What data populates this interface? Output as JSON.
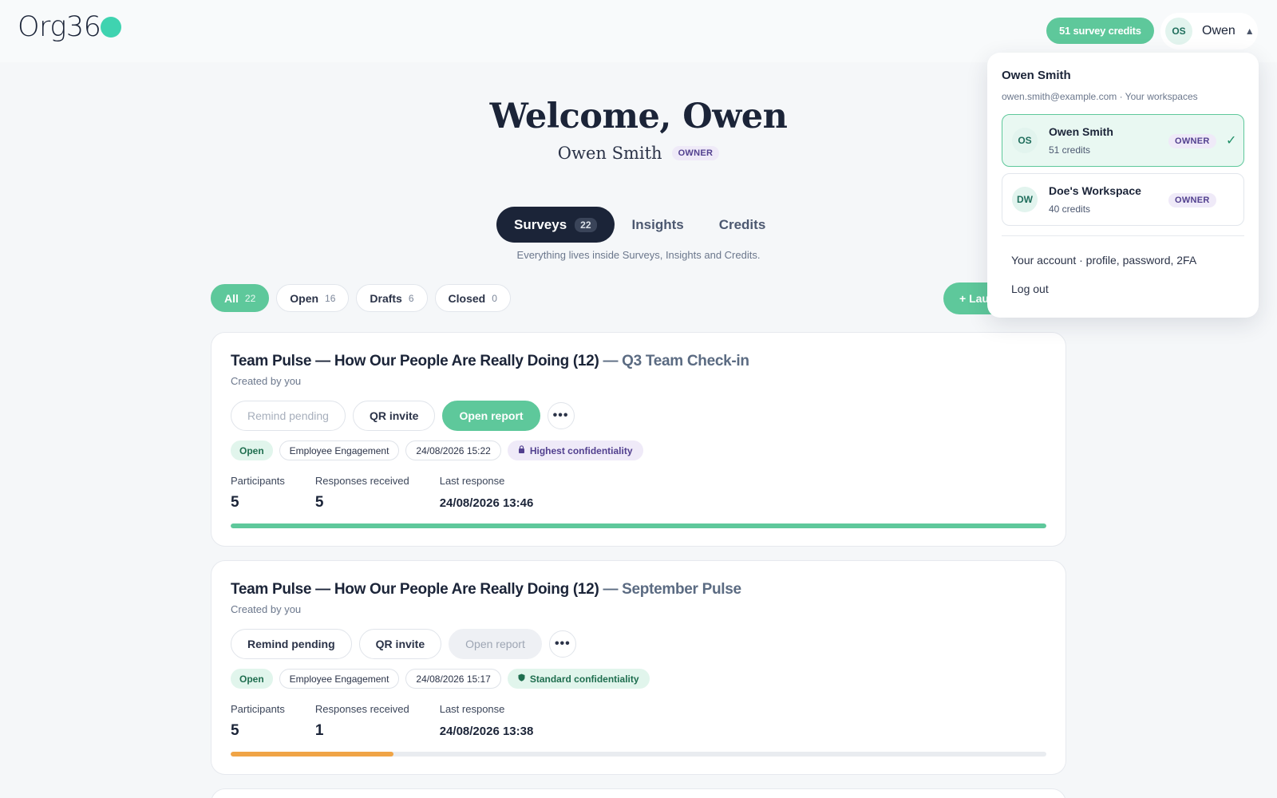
{
  "brand": {
    "logo_text": "Org36"
  },
  "header": {
    "credits_pill": "51 survey credits",
    "user_initials": "OS",
    "user_name": "Owen",
    "caret": "▲"
  },
  "hero": {
    "title": "Welcome, Owen",
    "full_name": "Owen Smith",
    "role_badge": "OWNER"
  },
  "tabs": [
    {
      "label": "Surveys",
      "count": "22",
      "active": true
    },
    {
      "label": "Insights"
    },
    {
      "label": "Credits"
    }
  ],
  "tabs_help": "Everything lives inside Surveys, Insights and Credits.",
  "filters": [
    {
      "label": "All",
      "count": "22",
      "active": true
    },
    {
      "label": "Open",
      "count": "16"
    },
    {
      "label": "Drafts",
      "count": "6"
    },
    {
      "label": "Closed",
      "count": "0"
    }
  ],
  "launch_button": "+ Lau",
  "surveys": [
    {
      "title": "Team Pulse — How Our People Are Really Doing (12)",
      "subtitle": "— Q3 Team Check-in",
      "created": "Created by you",
      "actions": {
        "remind": "Remind pending",
        "qr": "QR invite",
        "report": "Open report",
        "more": "•••"
      },
      "status": "Open",
      "category": "Employee Engagement",
      "datetime": "24/08/2026 15:22",
      "confidentiality": "Highest confidentiality",
      "confidentiality_icon": "lock-icon",
      "participants_label": "Participants",
      "participants": "5",
      "responses_label": "Responses received",
      "responses": "5",
      "last_response_label": "Last response",
      "last_response": "24/08/2026 13:46",
      "progress": 1.0,
      "progress_color": "#5ec89b"
    },
    {
      "title": "Team Pulse — How Our People Are Really Doing (12)",
      "subtitle": "— September Pulse",
      "created": "Created by you",
      "actions": {
        "remind": "Remind pending",
        "qr": "QR invite",
        "report": "Open report",
        "more": "•••"
      },
      "status": "Open",
      "category": "Employee Engagement",
      "datetime": "24/08/2026 15:17",
      "confidentiality": "Standard confidentiality",
      "confidentiality_icon": "shield-icon",
      "participants_label": "Participants",
      "participants": "5",
      "responses_label": "Responses received",
      "responses": "1",
      "last_response_label": "Last response",
      "last_response": "24/08/2026 13:38",
      "progress": 0.2,
      "progress_color": "#f0a446"
    }
  ],
  "account_menu": {
    "name": "Owen Smith",
    "email_line": "owen.smith@example.com · Your workspaces",
    "workspaces": [
      {
        "initials": "OS",
        "name": "Owen Smith",
        "credits": "51 credits",
        "role": "OWNER",
        "check": "✓",
        "active": true
      },
      {
        "initials": "DW",
        "name": "Doe's Workspace",
        "credits": "40 credits",
        "role": "OWNER"
      }
    ],
    "account_link": "Your account · profile, password, 2FA",
    "logout": "Log out"
  },
  "colors": {
    "accent": "#5ec89b",
    "dark": "#1b2438",
    "warning": "#f0a446",
    "logo_dot": "#3fd3b0"
  }
}
